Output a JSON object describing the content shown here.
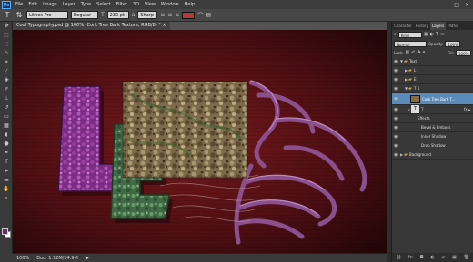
{
  "app": {
    "logo": "Ps"
  },
  "menu": [
    "File",
    "Edit",
    "Image",
    "Layer",
    "Type",
    "Select",
    "Filter",
    "3D",
    "View",
    "Window",
    "Help"
  ],
  "options": {
    "font_family": "Lithos Pro",
    "font_style": "Regular",
    "font_size": "230 pt",
    "antialias": "Sharp",
    "tool_icon": "type-tool-icon"
  },
  "document": {
    "tab_title": "Cool Typography.psd @ 100% (Cork Tree Bark Texture, RGB/8) *"
  },
  "status": {
    "zoom": "100%",
    "doc_size": "Doc: 1.72M/14.9M"
  },
  "panels": {
    "tabs": [
      "Character",
      "History",
      "Layers",
      "Paths"
    ],
    "kind_label": "Kind",
    "blend_mode": "Normal",
    "opacity_label": "Opacity:",
    "opacity_value": "100%",
    "lock_label": "Lock:",
    "fill_label": "Fill:",
    "fill_value": "100%"
  },
  "layers": [
    {
      "name": "Text",
      "type": "group",
      "indent": 0
    },
    {
      "name": "L",
      "type": "group",
      "indent": 1
    },
    {
      "name": "E",
      "type": "group",
      "indent": 1
    },
    {
      "name": "T 1",
      "type": "group",
      "indent": 1
    },
    {
      "name": "Cork Tree Bark T...",
      "type": "image",
      "indent": 2,
      "selected": true
    },
    {
      "name": "T",
      "type": "text",
      "indent": 2
    },
    {
      "name": "Effects",
      "type": "effects",
      "indent": 3
    },
    {
      "name": "Bevel & Emboss",
      "type": "effect",
      "indent": 4
    },
    {
      "name": "Inner Shadow",
      "type": "effect",
      "indent": 4
    },
    {
      "name": "Drop Shadow",
      "type": "effect",
      "indent": 4
    },
    {
      "name": "Background",
      "type": "group",
      "indent": 0
    }
  ],
  "colors": {
    "foreground": "#6a2a6a",
    "background": "#ffffff",
    "canvas_bg": "#3c0c10",
    "selection": "#5b8bb8"
  }
}
